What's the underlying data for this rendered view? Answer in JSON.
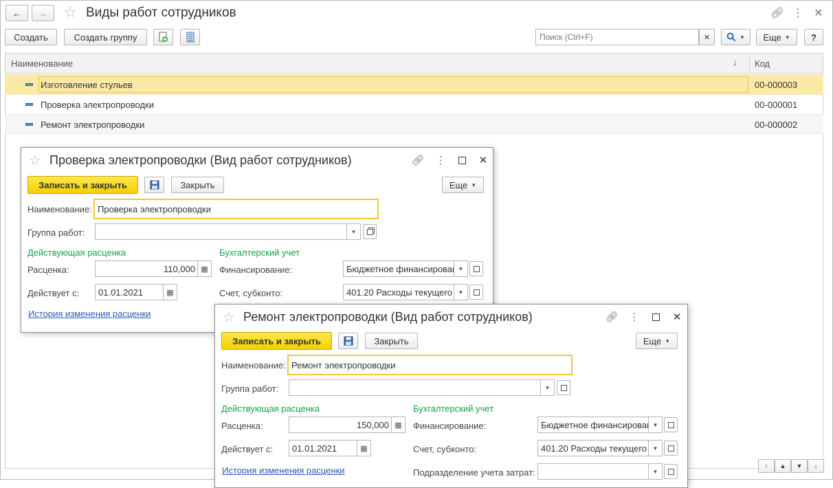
{
  "main": {
    "title": "Виды работ сотрудников",
    "toolbar": {
      "create": "Создать",
      "create_group": "Создать группу",
      "search_placeholder": "Поиск (Ctrl+F)",
      "more": "Еще",
      "help": "?"
    },
    "columns": {
      "name": "Наименование",
      "code": "Код"
    },
    "rows": [
      {
        "name": "Изготовление стульев",
        "code": "00-000003"
      },
      {
        "name": "Проверка электропроводки",
        "code": "00-000001"
      },
      {
        "name": "Ремонт электропроводки",
        "code": "00-000002"
      }
    ]
  },
  "dialog1": {
    "title": "Проверка электропроводки (Вид работ сотрудников)",
    "save_close": "Записать и закрыть",
    "close": "Закрыть",
    "more": "Еще",
    "name_label": "Наименование:",
    "name_value": "Проверка электропроводки",
    "group_label": "Группа работ:",
    "group_value": "",
    "rate_section": "Действующая расценка",
    "rate_label": "Расценка:",
    "rate_value": "110,000",
    "date_label": "Действует с:",
    "date_value": "01.01.2021",
    "acc_section": "Бухгалтерский учет",
    "fin_label": "Финансирование:",
    "fin_value": "Бюджетное финансирован",
    "account_label": "Счет, субконто:",
    "account_value": "401.20 Расходы текущего",
    "history_link": "История изменения расценки"
  },
  "dialog2": {
    "title": "Ремонт электропроводки (Вид работ сотрудников)",
    "save_close": "Записать и закрыть",
    "close": "Закрыть",
    "more": "Еще",
    "name_label": "Наименование:",
    "name_value": "Ремонт электропроводки",
    "group_label": "Группа работ:",
    "group_value": "",
    "rate_section": "Действующая расценка",
    "rate_label": "Расценка:",
    "rate_value": "150,000",
    "date_label": "Действует с:",
    "date_value": "01.01.2021",
    "acc_section": "Бухгалтерский учет",
    "fin_label": "Финансирование:",
    "fin_value": "Бюджетное финансирован",
    "account_label": "Счет, субконто:",
    "account_value": "401.20 Расходы текущего",
    "dept_label": "Подразделение учета затрат:",
    "dept_value": "",
    "history_link": "История изменения расценки"
  },
  "colors": {
    "accent_yellow": "#f5d100",
    "selected_row": "#fbe9a6",
    "section_green": "#15a04a",
    "link_blue": "#2a58b3"
  }
}
